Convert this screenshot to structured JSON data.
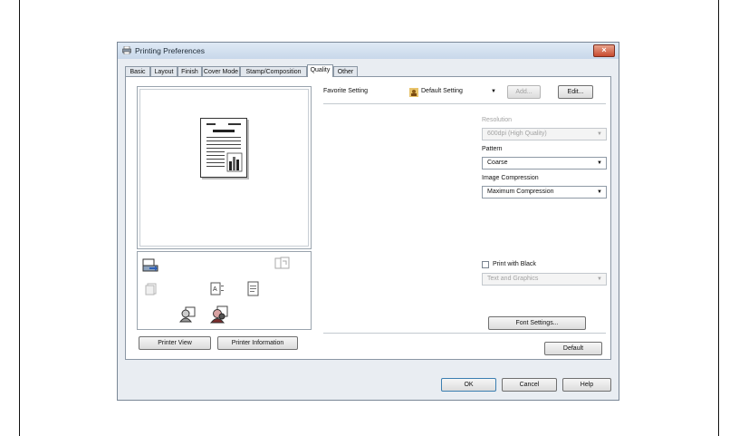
{
  "dialog": {
    "title": "Printing Preferences",
    "close_glyph": "×",
    "icon": "printer-icon"
  },
  "tabs": [
    {
      "label": "Basic"
    },
    {
      "label": "Layout"
    },
    {
      "label": "Finish"
    },
    {
      "label": "Cover Mode"
    },
    {
      "label": "Stamp/Composition"
    },
    {
      "label": "Quality",
      "active": true
    },
    {
      "label": "Other"
    }
  ],
  "quality": {
    "favorite_label": "Favorite Setting",
    "favorite_value": "Default Setting",
    "add_label": "Add...",
    "edit_label": "Edit...",
    "resolution_label": "Resolution",
    "resolution_value": "600dpi (High Quality)",
    "pattern_label": "Pattern",
    "pattern_value": "Coarse",
    "compression_label": "Image Compression",
    "compression_value": "Maximum Compression",
    "print_black_label": "Print with Black",
    "print_black_value": "Text and Graphics",
    "font_settings_label": "Font Settings...",
    "default_label": "Default"
  },
  "preview": {
    "printer_view_label": "Printer View",
    "printer_info_label": "Printer Information"
  },
  "footer": {
    "ok_label": "OK",
    "cancel_label": "Cancel",
    "help_label": "Help"
  }
}
